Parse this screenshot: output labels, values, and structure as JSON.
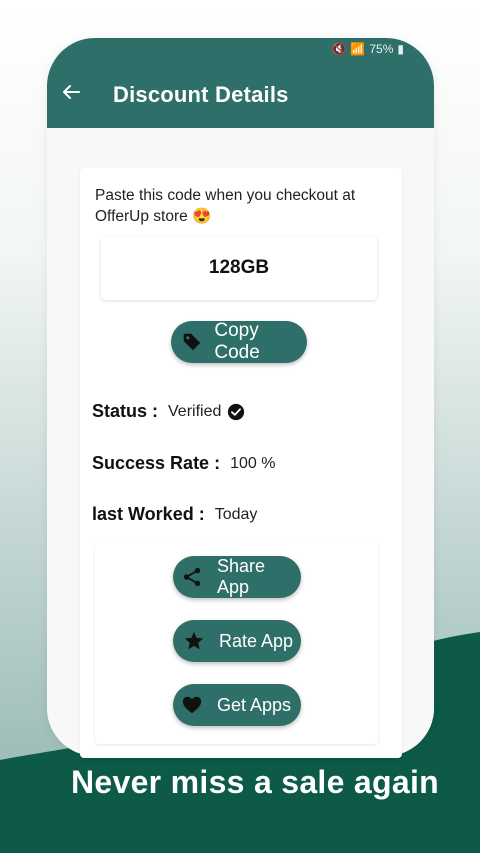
{
  "status_bar": {
    "battery_text": "75%"
  },
  "appbar": {
    "title": "Discount Details"
  },
  "coupon": {
    "instruction": "Paste this code when you checkout at OfferUp store",
    "emoji": "😍",
    "code": "128GB",
    "copy_label": "Copy Code"
  },
  "details": {
    "status_label": "Status :",
    "status_value": "Verified",
    "success_label": "Success Rate :",
    "success_value": "100 %",
    "last_label": "last Worked :",
    "last_value": "Today"
  },
  "actions": {
    "share_label": "Share App",
    "rate_label": "Rate App",
    "get_label": "Get Apps"
  },
  "promo": {
    "tagline": "Never miss a sale again"
  },
  "colors": {
    "primary": "#2f6f69",
    "dark_green": "#0d5a49",
    "background_light": "#f8f8f9"
  }
}
